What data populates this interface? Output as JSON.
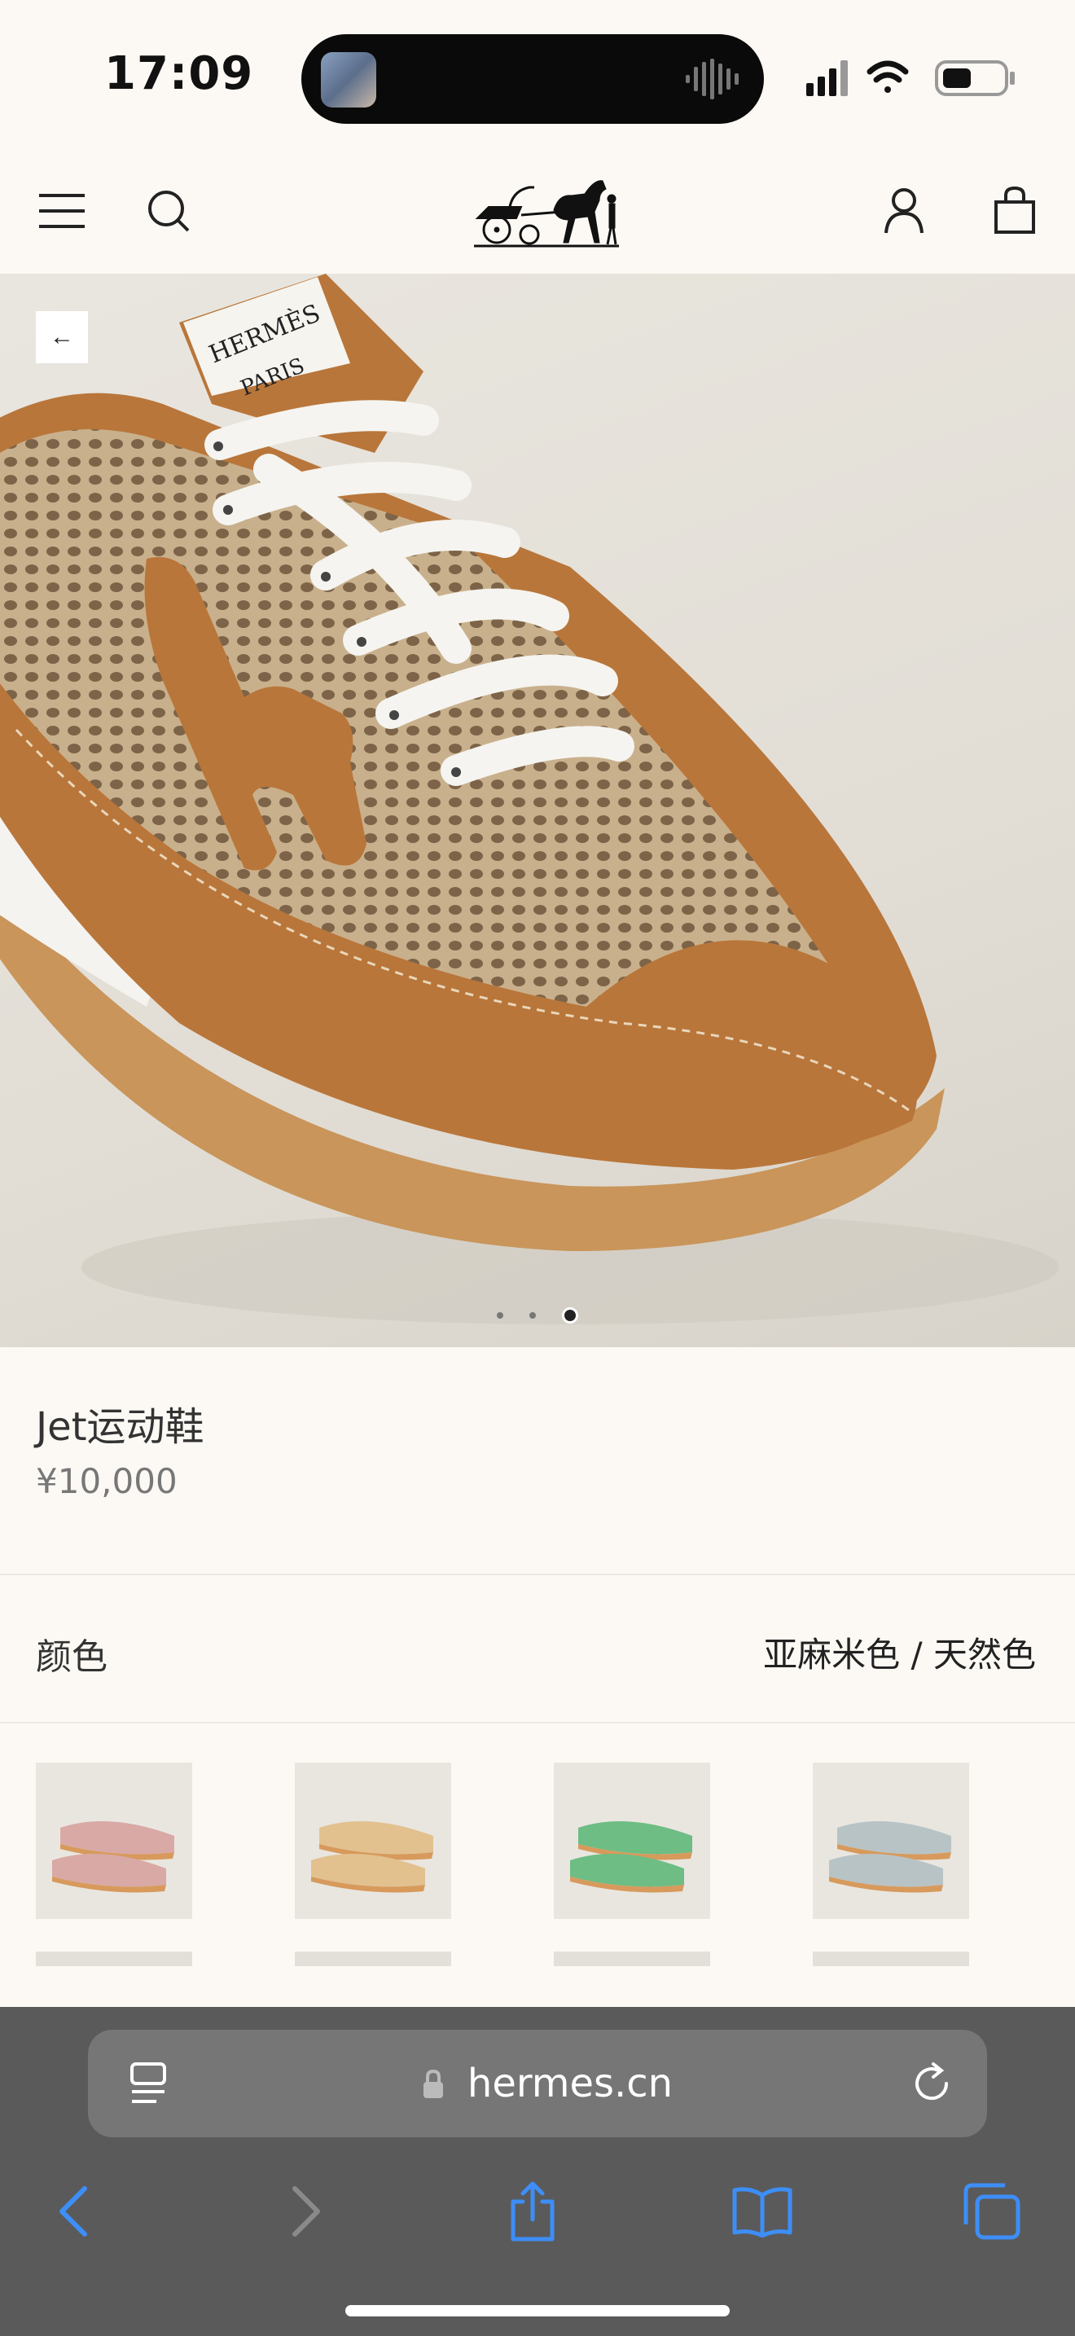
{
  "status_bar": {
    "time": "17:09"
  },
  "nav": {
    "menu_icon": "hamburger-menu-icon",
    "search_icon": "search-icon",
    "logo": "hermes-carriage-logo",
    "account_icon": "user-icon",
    "bag_icon": "shopping-bag-icon"
  },
  "hero": {
    "back_label": "←",
    "image_index": 3,
    "image_count": 3
  },
  "product": {
    "name": "Jet运动鞋",
    "price": "¥10,000"
  },
  "color": {
    "label": "颜色",
    "value": "亚麻米色 / 天然色"
  },
  "swatches": [
    {
      "name": "pink",
      "accent": "#d9a9a6"
    },
    {
      "name": "beige",
      "accent": "#e2c18f"
    },
    {
      "name": "green",
      "accent": "#6dbd84"
    },
    {
      "name": "grey",
      "accent": "#b8c3c6"
    }
  ],
  "safari": {
    "url": "hermes.cn",
    "tabs_icon": "tab-overview-icon",
    "reload_icon": "reload-icon",
    "back_icon": "back-chevron-icon",
    "forward_icon": "forward-chevron-icon",
    "share_icon": "share-icon",
    "bookmarks_icon": "bookmarks-icon",
    "tabs_button_icon": "tabs-icon"
  }
}
